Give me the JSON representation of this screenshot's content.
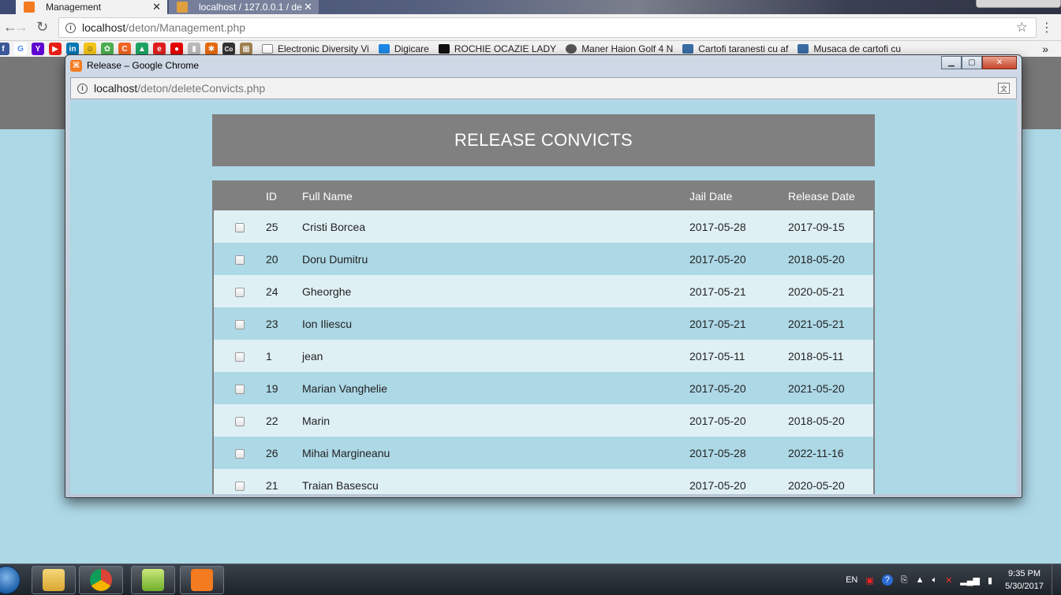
{
  "outer_browser": {
    "tabs": [
      {
        "label": "Management",
        "icon": "xampp-icon",
        "active": true
      },
      {
        "label": "localhost / 127.0.0.1 / de",
        "icon": "phpmyadmin-icon",
        "active": false
      }
    ],
    "address": {
      "host": "localhost",
      "path": "/deton/Management.php"
    },
    "bookmarks": [
      "Electronic Diversity Vi",
      "Digicare",
      "ROCHIE OCAZIE LADY",
      "Maner Haion Golf 4 N",
      "Cartofi taranesti cu af",
      "Musaca de cartofi cu"
    ],
    "more": "»"
  },
  "popup": {
    "title": "Release – Google Chrome",
    "address": {
      "host": "localhost",
      "path": "/deton/deleteConvicts.php"
    },
    "heading": "RELEASE CONVICTS",
    "table": {
      "columns": [
        "",
        "ID",
        "Full Name",
        "Jail Date",
        "Release Date"
      ],
      "rows": [
        {
          "id": "25",
          "name": "Cristi Borcea",
          "jail": "2017-05-28",
          "release": "2017-09-15"
        },
        {
          "id": "20",
          "name": "Doru Dumitru",
          "jail": "2017-05-20",
          "release": "2018-05-20"
        },
        {
          "id": "24",
          "name": "Gheorghe",
          "jail": "2017-05-21",
          "release": "2020-05-21"
        },
        {
          "id": "23",
          "name": "Ion Iliescu",
          "jail": "2017-05-21",
          "release": "2021-05-21"
        },
        {
          "id": "1",
          "name": "jean",
          "jail": "2017-05-11",
          "release": "2018-05-11"
        },
        {
          "id": "19",
          "name": "Marian Vanghelie",
          "jail": "2017-05-20",
          "release": "2021-05-20"
        },
        {
          "id": "22",
          "name": "Marin",
          "jail": "2017-05-20",
          "release": "2018-05-20"
        },
        {
          "id": "26",
          "name": "Mihai Margineanu",
          "jail": "2017-05-28",
          "release": "2022-11-16"
        },
        {
          "id": "21",
          "name": "Traian Basescu",
          "jail": "2017-05-20",
          "release": "2020-05-20"
        }
      ]
    }
  },
  "taskbar": {
    "language": "EN",
    "time": "9:35 PM",
    "date": "5/30/2017"
  },
  "colors": {
    "page_background": "#add8e6",
    "header_grey": "#808080",
    "row_light": "#dff0f5",
    "row_blue": "#add8e6"
  }
}
